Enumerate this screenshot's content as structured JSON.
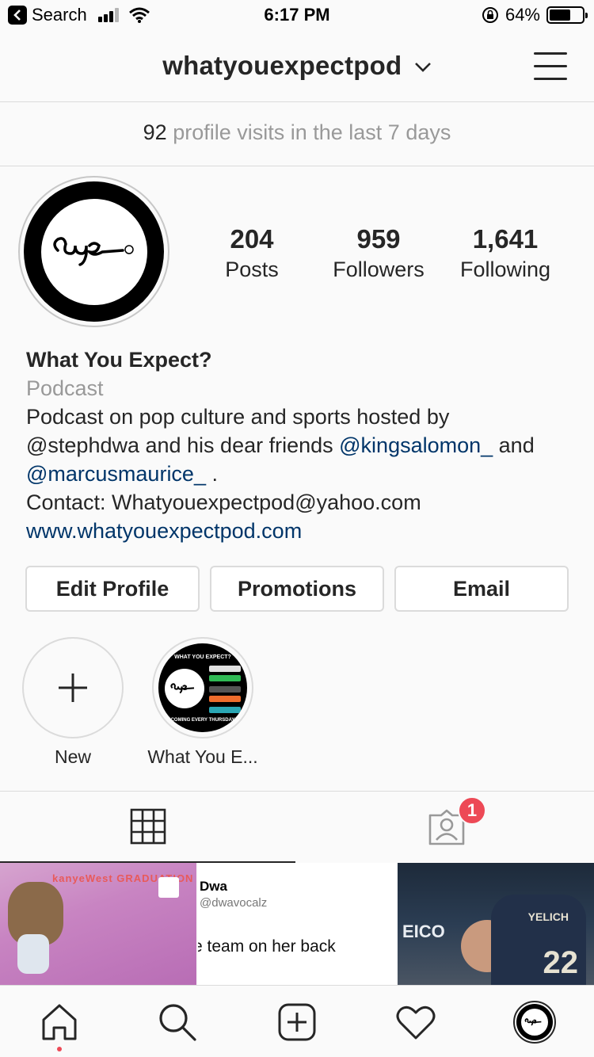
{
  "status_bar": {
    "back_label": "Search",
    "time": "6:17 PM",
    "battery": "64%",
    "battery_level": 0.64
  },
  "header": {
    "username": "whatyouexpectpod"
  },
  "visits": {
    "count": "92",
    "text": "profile visits in the last 7 days"
  },
  "stats": {
    "posts": {
      "value": "204",
      "label": "Posts"
    },
    "followers": {
      "value": "959",
      "label": "Followers"
    },
    "following": {
      "value": "1,641",
      "label": "Following"
    }
  },
  "bio": {
    "name": "What You Expect?",
    "category": "Podcast",
    "line1": "Podcast on pop culture and sports hosted by",
    "line2_prefix": "@stephdwa and his dear friends ",
    "mention1": "@kingsalomon_",
    "line2_suffix": " and",
    "mention2": "@marcusmaurice_",
    "line3_suffix": " .",
    "contact": "Contact: Whatyouexpectpod@yahoo.com",
    "website": "www.whatyouexpectpod.com"
  },
  "actions": {
    "edit_profile": "Edit Profile",
    "promotions": "Promotions",
    "email": "Email"
  },
  "highlights": {
    "new_label": "New",
    "item_label": "What You E...",
    "cover_top": "WHAT YOU EXPECT?",
    "cover_bottom": "COMING EVERY THURSDAY"
  },
  "tabs": {
    "tagged_badge": "1"
  },
  "grid": {
    "post1_title": "kanyeWest GRADUATION",
    "post2_name": "Dwa",
    "post2_handle": "@dwavocalz",
    "post2_text": "e team on her back",
    "post3_jersey": "YELICH",
    "post3_number": "22",
    "post3_sign": "EICO"
  },
  "colors": {
    "accent_link": "#003569",
    "badge": "#ed4956",
    "border": "#dbdbdb",
    "muted_text": "#999999"
  },
  "icons": {
    "back": "back-arrow-icon",
    "signal": "cell-signal-icon",
    "wifi": "wifi-icon",
    "lock": "orientation-lock-icon",
    "battery": "battery-icon",
    "menu": "hamburger-menu-icon",
    "chevron": "chevron-down-icon",
    "grid": "grid-icon",
    "tagged": "tagged-person-icon",
    "home": "home-icon",
    "search": "search-icon",
    "add": "add-post-icon",
    "heart": "heart-icon"
  }
}
